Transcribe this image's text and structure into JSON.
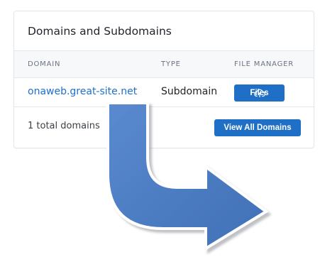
{
  "card": {
    "title": "Domains and Subdomains",
    "columns": {
      "domain": "DOMAIN",
      "type": "TYPE",
      "file_manager": "FILE MANAGER"
    },
    "rows": [
      {
        "domain": "onaweb.great-site.net",
        "type": "Subdomain",
        "action_label": "Files",
        "action_icon": "cloud-upload-icon"
      }
    ],
    "footer_text": "1 total domains",
    "view_all_label": "View All Domains"
  },
  "overlay": {
    "arrow_icon": "curved-arrow-right-icon",
    "arrow_color": "#4a7dc2"
  },
  "colors": {
    "link": "#1d6fd1",
    "button": "#1f6fc7"
  }
}
